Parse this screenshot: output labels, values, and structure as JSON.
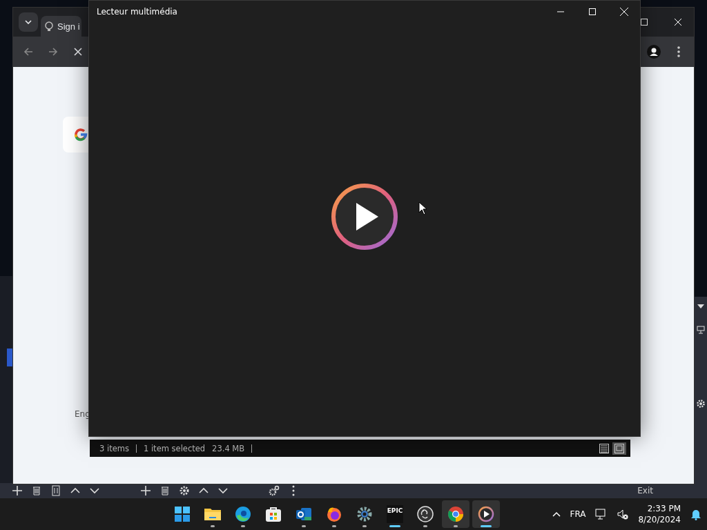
{
  "browser": {
    "tab_title": "Sign i",
    "footer_text": "Eng"
  },
  "player": {
    "title": "Lecteur multimédia"
  },
  "explorer_status": {
    "item_count": "3 items",
    "selection": "1 item selected",
    "size": "23.4 MB",
    "views": [
      {
        "kind": "details",
        "selected": false
      },
      {
        "kind": "large",
        "selected": true
      }
    ]
  },
  "obs": {
    "exit_label": "Exit"
  },
  "taskbar": {
    "apps": [
      {
        "kind": "start",
        "running": false,
        "focused": false,
        "selected": false
      },
      {
        "kind": "folder",
        "running": true,
        "focused": false,
        "selected": false
      },
      {
        "kind": "edge",
        "running": true,
        "focused": false,
        "selected": false
      },
      {
        "kind": "store",
        "running": false,
        "focused": false,
        "selected": false
      },
      {
        "kind": "outlook",
        "running": true,
        "focused": false,
        "selected": false
      },
      {
        "kind": "firefox",
        "running": true,
        "focused": false,
        "selected": false
      },
      {
        "kind": "settings",
        "running": true,
        "focused": false,
        "selected": false
      },
      {
        "kind": "epic",
        "label": "EPIC",
        "running": true,
        "focused": true,
        "selected": false
      },
      {
        "kind": "obs",
        "running": true,
        "focused": false,
        "selected": false
      },
      {
        "kind": "chrome",
        "running": true,
        "focused": false,
        "selected": true
      },
      {
        "kind": "player",
        "running": true,
        "focused": true,
        "selected": true
      }
    ],
    "language": "FRA",
    "time": "2:33 PM",
    "date": "8/20/2024"
  }
}
